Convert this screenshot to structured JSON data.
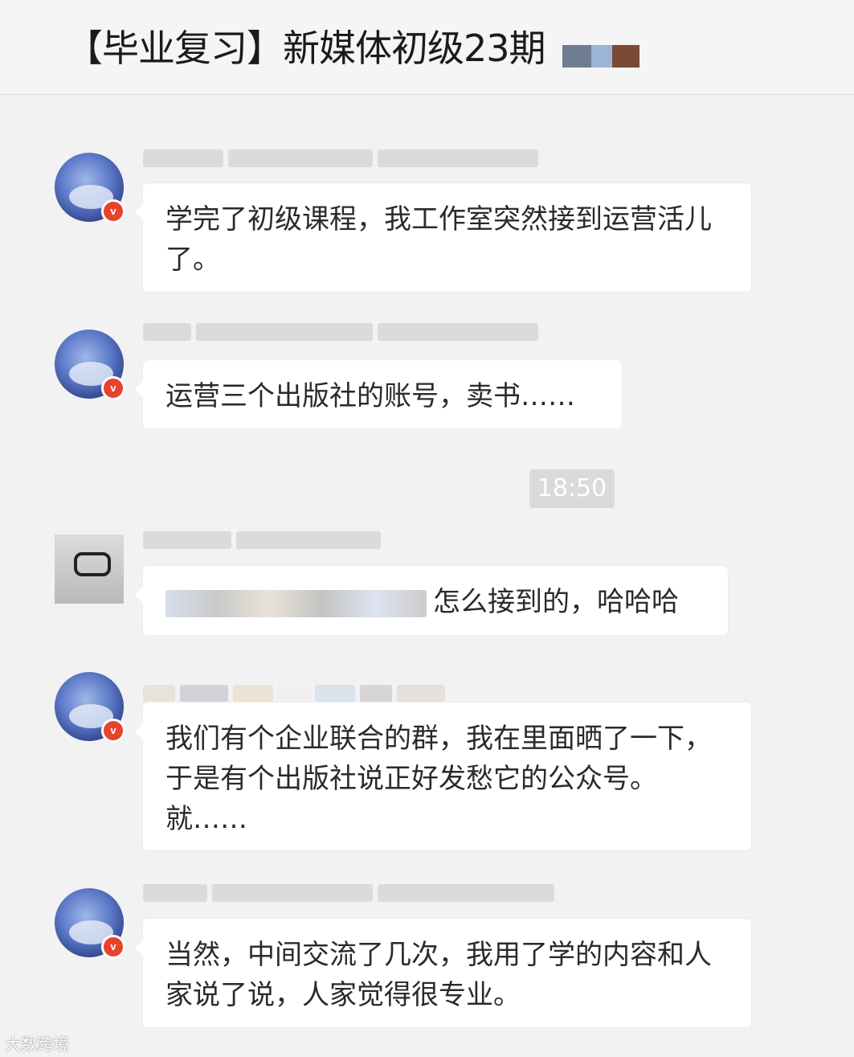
{
  "header": {
    "title": "【毕业复习】新媒体初级23期"
  },
  "messages": [
    {
      "text": "学完了初级课程，我工作室突然接到运营活儿了。"
    },
    {
      "text": "运营三个出版社的账号，卖书……"
    },
    {
      "text": "怎么接到的，哈哈哈"
    },
    {
      "text": "我们有个企业联合的群，我在里面晒了一下，于是有个出版社说正好发愁它的公众号。就……"
    },
    {
      "text": "当然，中间交流了几次，我用了学的内容和人家说了说，人家觉得很专业。"
    }
  ],
  "timestamp": "18:50",
  "badge": {
    "label": "v",
    "color": "#e5432b"
  },
  "watermark": "大数跨境",
  "colors": {
    "background": "#f2f2f2",
    "bubble": "#ffffff",
    "time_pill": "#dadada"
  }
}
